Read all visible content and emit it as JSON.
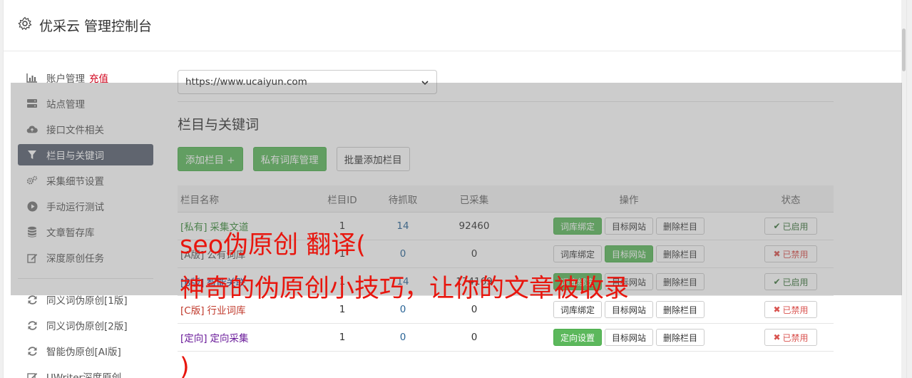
{
  "header": {
    "title": "优采云 管理控制台",
    "icon": "gear-icon"
  },
  "sidebar": {
    "items": [
      {
        "label": "账户管理",
        "extra": "充值",
        "icon": "bar-chart-icon"
      },
      {
        "label": "站点管理",
        "icon": "server-icon"
      },
      {
        "label": "接口文件相关",
        "icon": "cloud-upload-icon"
      },
      {
        "label": "栏目与关键词",
        "icon": "filter-icon",
        "active": true
      },
      {
        "label": "采集细节设置",
        "icon": "gears-icon"
      },
      {
        "label": "手动运行测试",
        "icon": "play-icon"
      },
      {
        "label": "文章暂存库",
        "icon": "database-icon"
      },
      {
        "label": "深度原创任务",
        "icon": "edit-icon"
      }
    ],
    "items2": [
      {
        "label": "同义词伪原创[1版]",
        "icon": "refresh-icon"
      },
      {
        "label": "同义词伪原创[2版]",
        "icon": "refresh-icon"
      },
      {
        "label": "智能伪原创[AI版]",
        "icon": "refresh-icon"
      },
      {
        "label": "UWriter深度原创",
        "icon": "edit-icon"
      }
    ]
  },
  "site_select": {
    "value": "https://www.ucaiyun.com"
  },
  "section": {
    "title": "栏目与关键词"
  },
  "buttons": {
    "add": "添加栏目 +",
    "private_lib": "私有词库管理",
    "batch_add": "批量添加栏目"
  },
  "table": {
    "headers": {
      "name": "栏目名称",
      "id": "栏目ID",
      "wait": "待抓取",
      "done": "已采集",
      "ops": "操作",
      "status": "状态"
    },
    "rows": [
      {
        "tag": "[私有]",
        "name": "采集文道",
        "tag_color": "#3c8d3c",
        "id": "1",
        "wait": "14",
        "done": "92460",
        "op1": "词库绑定",
        "op1_green": true,
        "op2": "目标网站",
        "op2_green": false,
        "op3": "删除栏目",
        "status": "已启用",
        "status_on": true
      },
      {
        "tag": "[A版]",
        "name": "公有词库",
        "tag_color": "#555555",
        "id": "1",
        "wait": "0",
        "done": "0",
        "op1": "词库绑定",
        "op1_green": false,
        "op2": "目标网站",
        "op2_green": true,
        "op3": "删除栏目",
        "status": "已禁用",
        "status_on": false
      },
      {
        "tag": "[B版]",
        "name": "智能关联",
        "tag_color": "#1a3d8f",
        "id": "1",
        "wait": "14",
        "done": "174169",
        "op1": "词库绑定",
        "op1_green": true,
        "op2": "目标网站",
        "op2_green": false,
        "op3": "删除栏目",
        "status": "已启用",
        "status_on": true
      },
      {
        "tag": "[C版]",
        "name": "行业词库",
        "tag_color": "#c0392b",
        "id": "1",
        "wait": "0",
        "done": "0",
        "op1": "词库绑定",
        "op1_green": false,
        "op2": "目标网站",
        "op2_green": false,
        "op3": "删除栏目",
        "status": "已禁用",
        "status_on": false
      },
      {
        "tag": "[定向]",
        "name": "定向采集",
        "tag_color": "#6a1b9a",
        "id": "1",
        "wait": "0",
        "done": "0",
        "op1": "定向设置",
        "op1_green": true,
        "op2": "目标网站",
        "op2_green": false,
        "op3": "删除栏目",
        "status": "已禁用",
        "status_on": false
      }
    ]
  },
  "watermark": {
    "line1": "seo伪原创 翻译(",
    "line2": "神奇的伪原创小技巧，让你的文章被收录",
    "line3": ")"
  }
}
